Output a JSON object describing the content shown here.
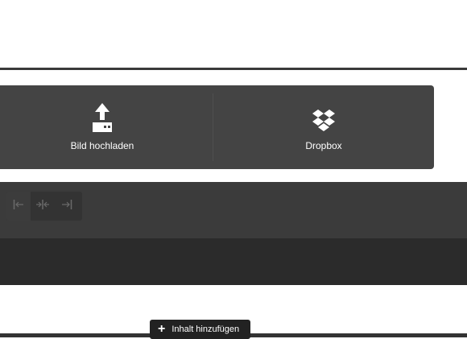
{
  "upload_panel": {
    "options": [
      {
        "label": "Bild hochladen",
        "icon": "upload-icon"
      },
      {
        "label": "Dropbox",
        "icon": "dropbox-icon"
      }
    ]
  },
  "toolbar": {
    "align_buttons": [
      {
        "icon": "align-left-icon"
      },
      {
        "icon": "align-center-icon"
      },
      {
        "icon": "align-right-icon"
      }
    ]
  },
  "add_content": {
    "label": "Inhalt hinzufügen",
    "icon": "plus-icon"
  },
  "colors": {
    "panel": "#444444",
    "toolbar": "#3b3b3b",
    "content": "#2b2b2b"
  }
}
